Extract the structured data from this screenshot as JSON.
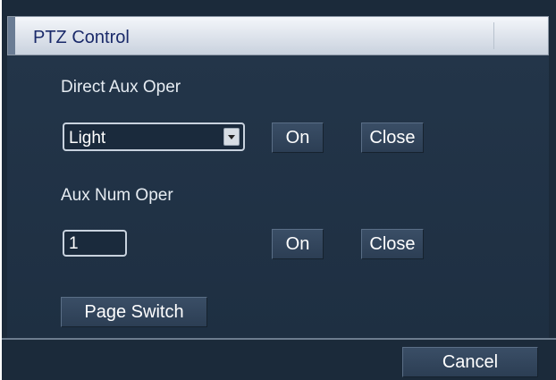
{
  "window": {
    "title": "PTZ Control"
  },
  "direct_aux": {
    "label": "Direct Aux Oper",
    "selected": "Light",
    "on_label": "On",
    "close_label": "Close"
  },
  "aux_num": {
    "label": "Aux Num Oper",
    "value": "1",
    "on_label": "On",
    "close_label": "Close"
  },
  "page_switch_label": "Page Switch",
  "footer": {
    "cancel_label": "Cancel"
  },
  "colors": {
    "panel_bg": "#1b2a3a",
    "title_text": "#1a2a6a"
  }
}
